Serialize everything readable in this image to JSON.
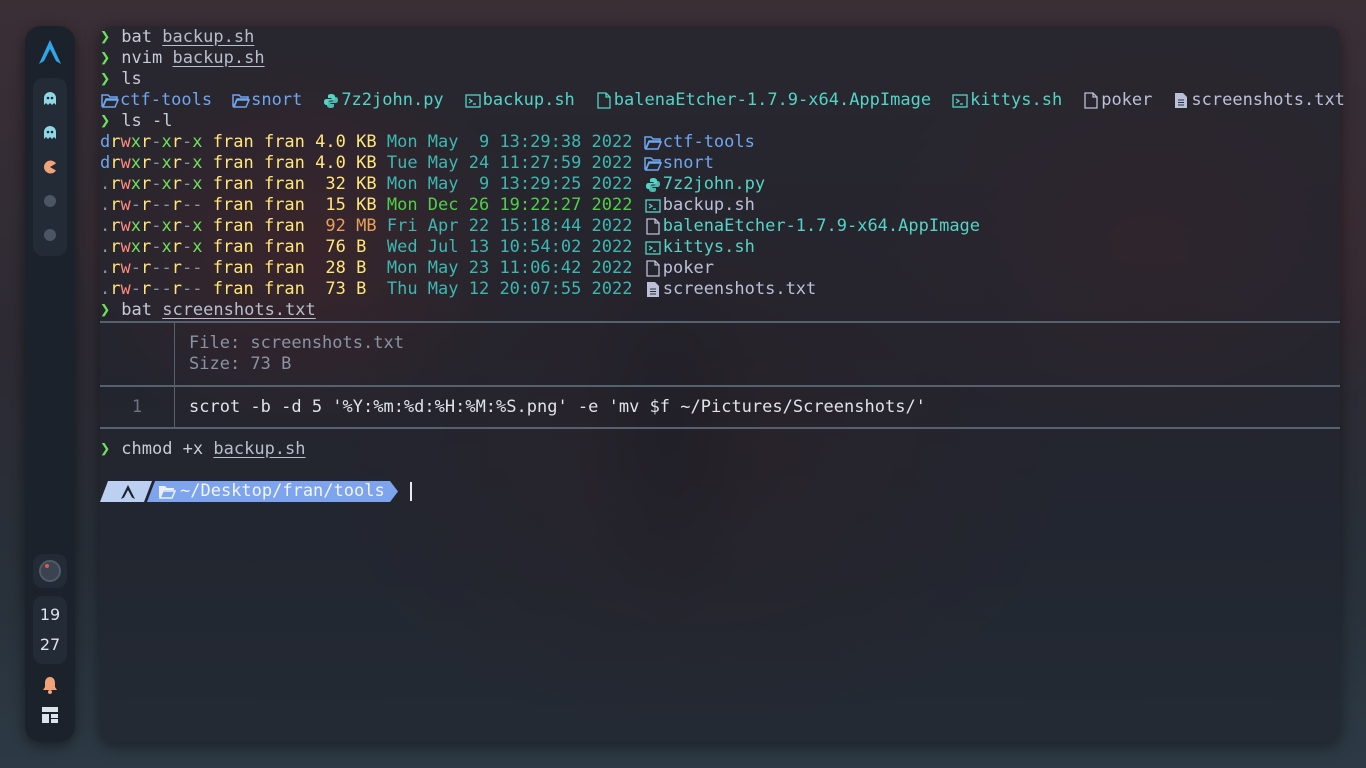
{
  "sidebar": {
    "workspaces": [
      {
        "name": "ghost-icon"
      },
      {
        "name": "ghost-icon"
      },
      {
        "name": "pacman-icon"
      },
      {
        "name": "dot"
      },
      {
        "name": "dot"
      }
    ],
    "clock": {
      "hour": "19",
      "minute": "27"
    }
  },
  "terminal": {
    "history": [
      {
        "cmd": "bat",
        "arg": "backup.sh"
      },
      {
        "cmd": "nvim",
        "arg": "backup.sh"
      },
      {
        "cmd": "ls",
        "arg": ""
      }
    ],
    "ls_items": [
      {
        "name": "ctf-tools",
        "icon": "folder-icon",
        "color": "#6ea6ef"
      },
      {
        "name": "snort",
        "icon": "folder-icon",
        "color": "#6ea6ef"
      },
      {
        "name": "7z2john.py",
        "icon": "python-icon",
        "color": "#54d3c7"
      },
      {
        "name": "backup.sh",
        "icon": "terminal-file-icon",
        "color": "#54d3c7"
      },
      {
        "name": "balenaEtcher-1.7.9-x64.AppImage",
        "icon": "file-icon",
        "color": "#54d3c7"
      },
      {
        "name": "kittys.sh",
        "icon": "terminal-file-icon",
        "color": "#54d3c7"
      },
      {
        "name": "poker",
        "icon": "file-icon",
        "color": "#b9c0d8"
      },
      {
        "name": "screenshots.txt",
        "icon": "text-file-icon",
        "color": "#b9c0d8"
      }
    ],
    "ls_l_cmd": "ls -l",
    "ls_l_rows": [
      {
        "perm": "drwxr-xr-x",
        "user": "fran",
        "group": "fran",
        "size": "4.0",
        "unit": "KB",
        "date": "Mon May  9 13:29:38 2022",
        "name": "ctf-tools",
        "icon": "folder-icon"
      },
      {
        "perm": "drwxr-xr-x",
        "user": "fran",
        "group": "fran",
        "size": "4.0",
        "unit": "KB",
        "date": "Tue May 24 11:27:59 2022",
        "name": "snort",
        "icon": "folder-icon"
      },
      {
        "perm": ".rwxr-xr-x",
        "user": "fran",
        "group": "fran",
        "size": " 32",
        "unit": "KB",
        "date": "Mon May  9 13:29:25 2022",
        "name": "7z2john.py",
        "icon": "python-icon"
      },
      {
        "perm": ".rw-r--r--",
        "user": "fran",
        "group": "fran",
        "size": " 15",
        "unit": "KB",
        "date": "Mon Dec 26 19:22:27 2022",
        "name": "backup.sh",
        "icon": "terminal-file-icon"
      },
      {
        "perm": ".rwxr-xr-x",
        "user": "fran",
        "group": "fran",
        "size": " 92",
        "unit": "MB",
        "date": "Fri Apr 22 15:18:44 2022",
        "name": "balenaEtcher-1.7.9-x64.AppImage",
        "icon": "file-icon"
      },
      {
        "perm": ".rwxr-xr-x",
        "user": "fran",
        "group": "fran",
        "size": " 76",
        "unit": "B ",
        "date": "Wed Jul 13 10:54:02 2022",
        "name": "kittys.sh",
        "icon": "terminal-file-icon"
      },
      {
        "perm": ".rw-r--r--",
        "user": "fran",
        "group": "fran",
        "size": " 28",
        "unit": "B ",
        "date": "Mon May 23 11:06:42 2022",
        "name": "poker",
        "icon": "file-icon"
      },
      {
        "perm": ".rw-r--r--",
        "user": "fran",
        "group": "fran",
        "size": " 73",
        "unit": "B ",
        "date": "Thu May 12 20:07:55 2022",
        "name": "screenshots.txt",
        "icon": "text-file-icon"
      }
    ],
    "bat_cmd": {
      "cmd": "bat",
      "arg": "screenshots.txt"
    },
    "bat": {
      "file_label": "File: screenshots.txt",
      "size_label": "Size: 73 B",
      "line_no": "1",
      "line": "scrot -b -d 5 '%Y:%m:%d:%H:%M:%S.png' -e 'mv $f ~/Pictures/Screenshots/'"
    },
    "chmod_cmd": {
      "cmd": "chmod +x",
      "arg": "backup.sh"
    },
    "prompt": {
      "path": "~/Desktop/fran/tools"
    }
  },
  "colors": {
    "prompt_arrow": "#6fe05c",
    "powerline_dark": "#bcd0f2",
    "powerline_path": "#7ea4ee"
  }
}
